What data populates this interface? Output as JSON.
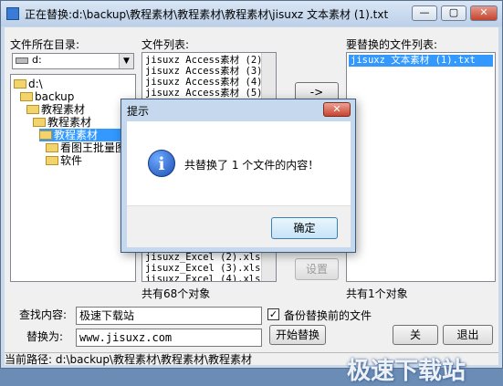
{
  "window": {
    "title": "正在替换:d:\\backup\\教程素材\\教程素材\\教程素材\\jisuxz 文本素材 (1).txt",
    "minimize": "—",
    "maximize": "▢",
    "close": "✕"
  },
  "left": {
    "label": "文件所在目录:",
    "drive": "d:",
    "tree": [
      "d:\\",
      "backup",
      "教程素材",
      "教程素材",
      "教程素材",
      "看图王批量图",
      "软件"
    ]
  },
  "middle": {
    "label": "文件列表:",
    "files_top": [
      "jisuxz Access素材 (2).md",
      "jisuxz Access素材 (3).md",
      "jisuxz Access素材 (4).md",
      "jisuxz Access素材 (5).md"
    ],
    "files_bottom": [
      "jisuxz_Excel (2).xls",
      "jisuxz_Excel (3).xls",
      "jisuxz_Excel (4).xls"
    ],
    "count": "共有68个对象"
  },
  "buttons": {
    "move": "->",
    "settings": "设置"
  },
  "right": {
    "label": "要替换的文件列表:",
    "files": [
      "jisuxz 文本素材 (1).txt"
    ],
    "count": "共有1个对象"
  },
  "find": {
    "label": "查找内容:",
    "value": "极速下载站"
  },
  "replace": {
    "label": "替换为:",
    "value": "www.jisuxz.com"
  },
  "backup": {
    "checked": "✓",
    "label": "备份替换前的文件"
  },
  "start_button": "开始替换",
  "close_button": "关",
  "exit_button": "退出",
  "status": "当前路径: d:\\backup\\教程素材\\教程素材\\教程素材",
  "dialog": {
    "title": "提示",
    "close": "✕",
    "icon": "i",
    "message": "共替换了 1 个文件的内容！",
    "ok": "确定"
  },
  "watermark": "极速下载站"
}
